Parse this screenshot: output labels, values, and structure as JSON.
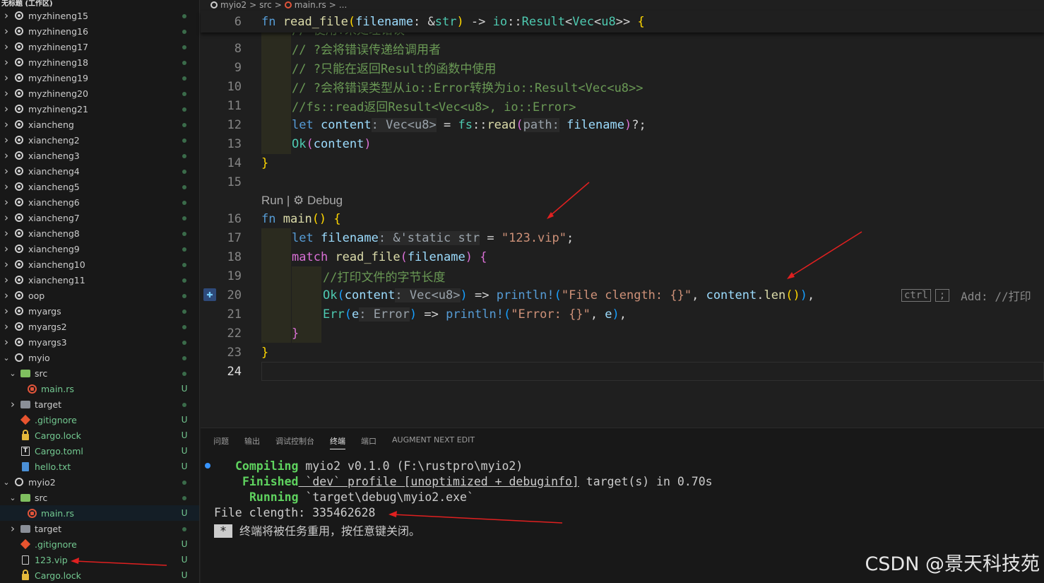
{
  "sidebar": {
    "workspace_title": "无标题 (工作区)",
    "items": [
      {
        "label": "myzhineng15",
        "badge": ""
      },
      {
        "label": "myzhineng16",
        "badge": ""
      },
      {
        "label": "myzhineng17",
        "badge": ""
      },
      {
        "label": "myzhineng18",
        "badge": ""
      },
      {
        "label": "myzhineng19",
        "badge": ""
      },
      {
        "label": "myzhineng20",
        "badge": ""
      },
      {
        "label": "myzhineng21",
        "badge": ""
      },
      {
        "label": "xiancheng",
        "badge": ""
      },
      {
        "label": "xiancheng2",
        "badge": ""
      },
      {
        "label": "xiancheng3",
        "badge": ""
      },
      {
        "label": "xiancheng4",
        "badge": ""
      },
      {
        "label": "xiancheng5",
        "badge": ""
      },
      {
        "label": "xiancheng6",
        "badge": ""
      },
      {
        "label": "xiancheng7",
        "badge": ""
      },
      {
        "label": "xiancheng8",
        "badge": ""
      },
      {
        "label": "xiancheng9",
        "badge": ""
      },
      {
        "label": "xiancheng10",
        "badge": ""
      },
      {
        "label": "xiancheng11",
        "badge": ""
      },
      {
        "label": "oop",
        "badge": ""
      },
      {
        "label": "myargs",
        "badge": ""
      },
      {
        "label": "myargs2",
        "badge": ""
      },
      {
        "label": "myargs3",
        "badge": ""
      },
      {
        "label": "myio",
        "badge": ""
      },
      {
        "label": "src",
        "badge": ""
      },
      {
        "label": "main.rs",
        "badge": "U"
      },
      {
        "label": "target",
        "badge": ""
      },
      {
        "label": ".gitignore",
        "badge": "U"
      },
      {
        "label": "Cargo.lock",
        "badge": "U"
      },
      {
        "label": "Cargo.toml",
        "badge": "U"
      },
      {
        "label": "hello.txt",
        "badge": "U"
      },
      {
        "label": "myio2",
        "badge": ""
      },
      {
        "label": "src",
        "badge": ""
      },
      {
        "label": "main.rs",
        "badge": "U"
      },
      {
        "label": "target",
        "badge": ""
      },
      {
        "label": ".gitignore",
        "badge": "U"
      },
      {
        "label": "123.vip",
        "badge": "U"
      },
      {
        "label": "Cargo.lock",
        "badge": "U"
      }
    ]
  },
  "editor": {
    "breadcrumb": [
      "myio2",
      ">",
      "src",
      ">",
      "main.rs",
      ">",
      "..."
    ],
    "sticky_line_number": "6",
    "line_numbers": [
      "8",
      "9",
      "10",
      "11",
      "12",
      "13",
      "14",
      "15",
      "16",
      "17",
      "18",
      "19",
      "20",
      "21",
      "22",
      "23",
      "24"
    ],
    "codelens": "Run | ⚙ Debug",
    "inline_suggestion": "Add: //打印",
    "ctrl_hint": "ctrl"
  },
  "panel": {
    "tabs": [
      "问题",
      "输出",
      "调试控制台",
      "终端",
      "端口",
      "AUGMENT NEXT EDIT"
    ],
    "active_tab": "终端",
    "terminal": {
      "compiling_label": "Compiling",
      "compiling_text": " myio2 v0.1.0 (F:\\rustpro\\myio2)",
      "finished_label": "Finished",
      "finished_text_pre": " `dev` profile [unoptimized + debuginfo]",
      "finished_text_post": " target(s) in 0.70s",
      "running_label": "Running",
      "running_text": " `target\\debug\\myio2.exe`",
      "output": "File clength: 335462628",
      "reuse_star": "*",
      "reuse_msg": "终端将被任务重用，按任意键关闭。"
    }
  },
  "watermark": "CSDN @景天科技苑"
}
